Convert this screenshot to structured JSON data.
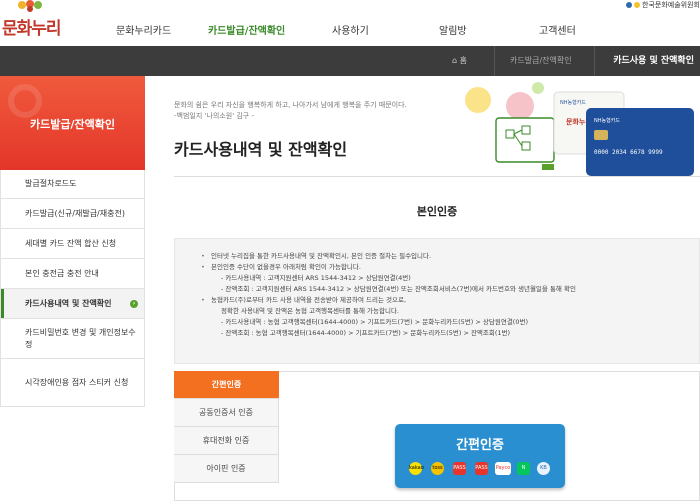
{
  "header": {
    "logo_text": "문화누리",
    "gnb": [
      {
        "label": "문화누리카드"
      },
      {
        "label": "카드발급/잔액확인",
        "active": true
      },
      {
        "label": "사용하기"
      },
      {
        "label": "알림방"
      },
      {
        "label": "고객센터"
      }
    ],
    "top_util": "한국문화예술위원회"
  },
  "breadcrumb": {
    "home": "홈",
    "parent": "카드발급/잔액확인",
    "current": "카드사용 및 잔액확인"
  },
  "sidebar": {
    "title": "카드발급/잔액확인",
    "items": [
      {
        "label": "발급절차로드도"
      },
      {
        "label": "카드발급(신규/재발급/재충전)"
      },
      {
        "label": "세대별 카드 잔액 합산 신청"
      },
      {
        "label": "본인 충전금 충전 안내"
      },
      {
        "label": "카드사용내역 및 잔액확인",
        "active": true
      },
      {
        "label": "카드비밀번호 변경 및 개인정보수정"
      },
      {
        "label": "시각장애인용 점자 스티커 신청"
      }
    ]
  },
  "main": {
    "quote_line1": "문화의 쉼은 우리 자신을 행복하게 하고, 나아가서 남에게 행복을 주기 때문이다.",
    "quote_line2": "-백범일지 '나의소원' 김구 -",
    "title": "카드사용내역 및 잔액확인",
    "hero": {
      "card1_brand": "NH농협카드",
      "card1_name": "문화누리",
      "card2_brand": "NH농협카드",
      "card2_number": "0000 2034 6678 9999"
    },
    "section_title": "본인인증",
    "info_lines": [
      {
        "type": "b",
        "text": "인터넷 누리집을 통한 카드사용내역 및 잔액확인시, 본인 인증 절차는 필수입니다."
      },
      {
        "type": "b",
        "text": "본인인증 수단이 없을경우 아래처럼 확인이 가능합니다."
      },
      {
        "type": "s",
        "text": "- 카드사용내역 : 고객지원센터 ARS 1544-3412 > 상담원연결(4번)"
      },
      {
        "type": "s",
        "text": "- 잔액조회 : 고객지원센터 ARS 1544-3412 > 상담원연결(4번) 또는 잔액조회서비스(7번)에서 카드번호와 생년월일을 통해 확인"
      },
      {
        "type": "b",
        "text": "농협카드(주)로부터 카드 사용 내역을 전송받아 제공하여 드리는 것으로,"
      },
      {
        "type": "s",
        "text": "정확한 사용내역 및 잔액은 농협 고객행복센터를 통해 가능합니다."
      },
      {
        "type": "s",
        "text": "- 카드사용내역 : 농협 고객행복센터(1644-4000) > 기프트카드(7번) > 문화누리카드(5번) > 상담원연결(0번)"
      },
      {
        "type": "s",
        "text": "- 잔액조회 : 농협 고객행복센터(1644-4000) > 기프트카드(7번) > 문화누리카드(5번) > 잔액조회(1번)"
      }
    ],
    "tabs": [
      {
        "label": "간편인증",
        "active": true
      },
      {
        "label": "공동인증서 인증"
      },
      {
        "label": "휴대전화 인증"
      },
      {
        "label": "아이핀 인증"
      }
    ],
    "auth_button_label": "간편인증",
    "providers": [
      {
        "label": "kakao",
        "color": "#fae100"
      },
      {
        "label": "toss",
        "color": "#f5c400"
      },
      {
        "label": "PASS",
        "color": "#e8352b"
      },
      {
        "label": "PASS",
        "color": "#e8352b"
      },
      {
        "label": "Payco",
        "color": "#ffffff"
      },
      {
        "label": "N",
        "color": "#03c75a"
      },
      {
        "label": "KB",
        "color": "#e7f2fb"
      }
    ],
    "colors": {
      "accent_orange": "#f37021",
      "accent_green": "#3a8a2a",
      "auth_blue": "#2a8fd0",
      "side_red": "#e3362a"
    }
  }
}
